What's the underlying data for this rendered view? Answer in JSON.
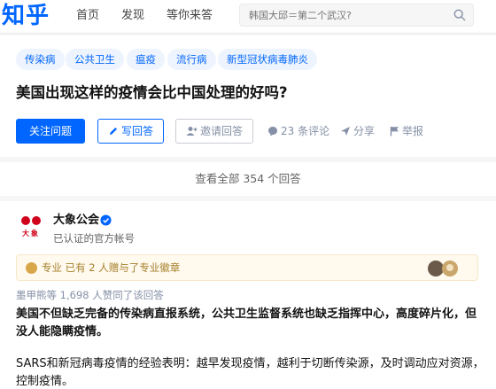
{
  "header": {
    "logo": "知乎",
    "nav": {
      "home": "首页",
      "discover": "发现",
      "answer": "等你来答"
    },
    "search_placeholder": "韩国大邱＝第二个武汉?"
  },
  "question": {
    "topics": [
      "传染病",
      "公共卫生",
      "瘟疫",
      "流行病",
      "新型冠状病毒肺炎"
    ],
    "title": "美国出现这样的疫情会比中国处理的好吗?",
    "follow_label": "关注问题",
    "write_label": "写回答",
    "invite_label": "邀请回答",
    "comments_label": "23 条评论",
    "share_label": "分享",
    "report_label": "举报"
  },
  "view_all_label": "查看全部 354 个回答",
  "answer": {
    "author_name": "大象公会",
    "author_desc": "已认证的官方帐号",
    "avatar_text": "大象",
    "pro_text": "专业 已有 2 人赠与了专业徽章",
    "upvote_text": "墨甲熊等 1,698 人赞同了该回答",
    "para_bold": "美国不但缺乏完备的传染病直报系统，公共卫生监督系统也缺乏指挥中心，高度碎片化，但没人能隐瞒疫情。",
    "para_normal": "SARS和新冠病毒疫情的经验表明：越早发现疫情，越利于切断传染源，及时调动应对资源，控制疫情。"
  },
  "colors": {
    "brand": "#0066ff",
    "muted": "#8590a6",
    "pro_gold": "#d7a74a"
  }
}
